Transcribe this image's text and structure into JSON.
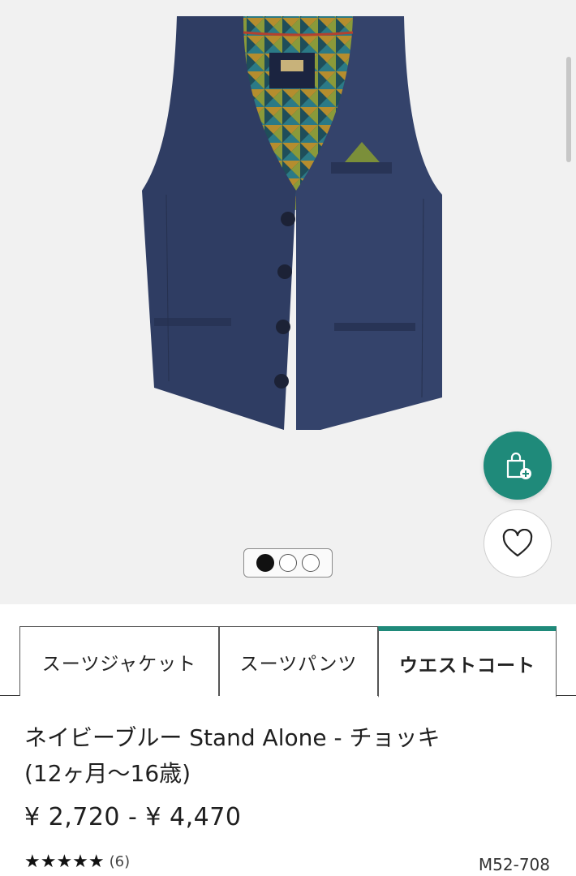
{
  "product": {
    "title_line1": "ネイビーブルー Stand Alone - チョッキ",
    "title_line2": "(12ヶ月〜16歳)",
    "price": "¥ 2,720 - ¥ 4,470",
    "stars": "★★★★★",
    "rating_count": "(6)",
    "code": "M52-708"
  },
  "tabs": [
    {
      "label": "スーツジャケット"
    },
    {
      "label": "スーツパンツ"
    },
    {
      "label": "ウエストコート",
      "active": true
    }
  ],
  "gallery": {
    "image_count": 3,
    "active_index": 0
  },
  "buttons": {
    "add_to_bag_icon": "shopping-bag-plus-icon",
    "favourite_icon": "heart-icon"
  },
  "colors": {
    "accent": "#1f8a7a",
    "vest": "#2f3d63",
    "background": "#f1f1f1"
  }
}
